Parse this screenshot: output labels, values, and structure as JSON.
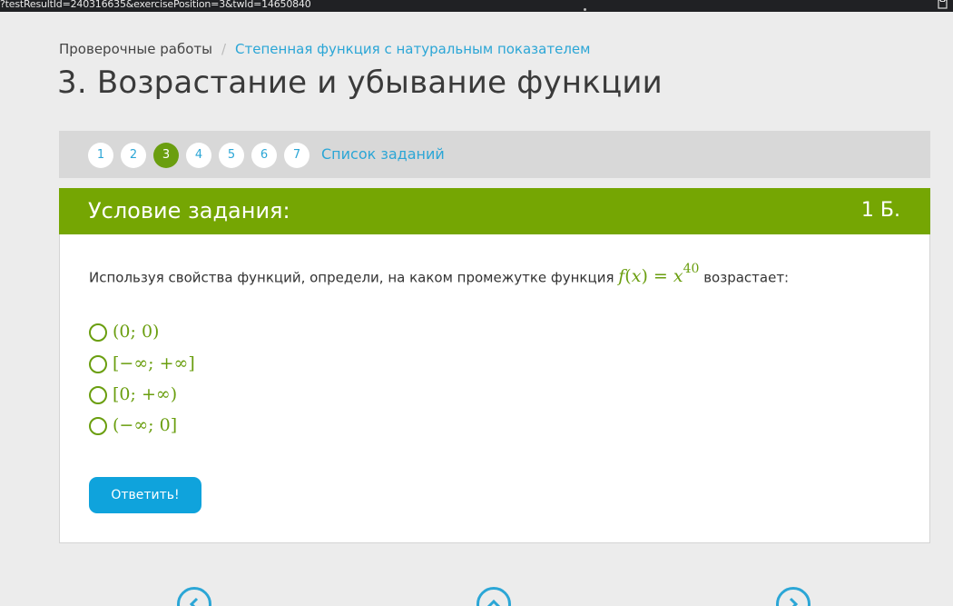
{
  "browser": {
    "url": "?testResultId=240316635&exercisePosition=3&twId=14650840",
    "extension_icon": "clipboard-icon"
  },
  "breadcrumb": {
    "home": "Проверочные работы",
    "separator": "/",
    "section": "Степенная функция с натуральным показателем"
  },
  "page_title": "3. Возрастание и убывание функции",
  "task_nav": {
    "numbers": [
      "1",
      "2",
      "3",
      "4",
      "5",
      "6",
      "7"
    ],
    "active": "3",
    "list_link": "Список заданий"
  },
  "task": {
    "header_title": "Условие задания:",
    "points": "1 Б.",
    "question_before": "Используя свойства функций, определи, на каком промежутке функция",
    "question_math": {
      "func": "f",
      "arg": "x",
      "equals": "=",
      "base": "x",
      "exponent": "40"
    },
    "question_after": "возрастает:",
    "options": [
      "(0; 0)",
      "[−∞; +∞]",
      "[0; +∞)",
      "(−∞; 0]"
    ],
    "submit_label": "Ответить!"
  },
  "bottom_nav": {
    "prev_icon": "chevron-left-icon",
    "up_icon": "chevron-up-icon",
    "next_icon": "chevron-right-icon"
  },
  "colors": {
    "accent_green": "#75a603",
    "math_green": "#6a9e0f",
    "link_blue": "#2ba6d6",
    "button_blue": "#0fa3dc",
    "nav_bar": "#d8d8d8"
  }
}
